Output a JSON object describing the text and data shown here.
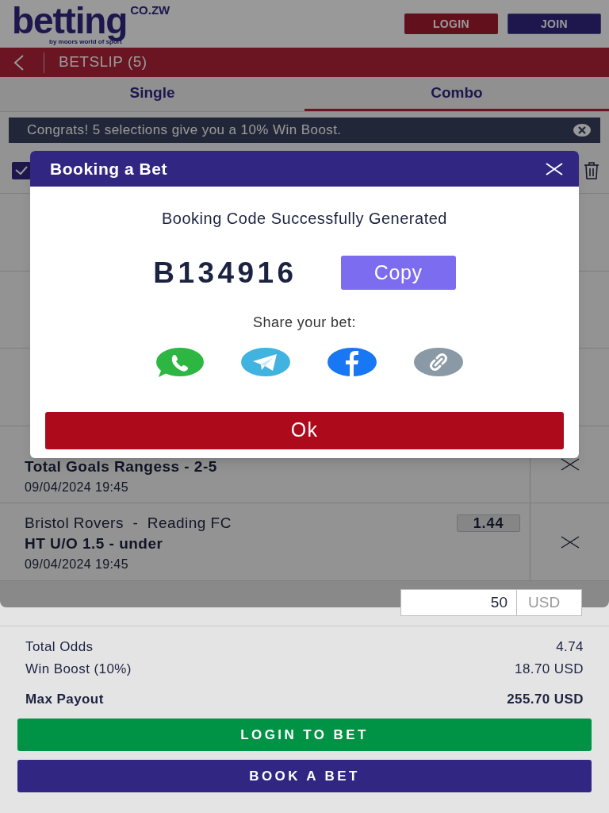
{
  "header": {
    "logo": {
      "word": "betting",
      "domain": "CO.ZW",
      "tagline": "by moors world of sport"
    },
    "buttons": [
      {
        "label": "LOGIN",
        "kind": "login"
      },
      {
        "label": "JOIN",
        "kind": "join"
      }
    ]
  },
  "betslip": {
    "title": "BETSLIP (5)"
  },
  "tabs": [
    {
      "label": "Single",
      "selected": false
    },
    {
      "label": "Combo",
      "selected": true
    }
  ],
  "banner": {
    "text": "Congrats! 5 selections give you a 10% Win Boost."
  },
  "select_all": {
    "checked": true
  },
  "selections": [
    {
      "market": "Total Goals Rangess - 2-5",
      "time": "09/04/2024 19:45"
    },
    {
      "teams": "Bristol Rovers  -  Reading FC",
      "market": "HT U/O 1.5 - under",
      "time": "09/04/2024 19:45",
      "odds": "1.44"
    }
  ],
  "stake": {
    "value": "50",
    "currency": "USD"
  },
  "summary": [
    {
      "label": "Total Odds",
      "value": "4.74",
      "kind": "normal"
    },
    {
      "label": "Win Boost (10%)",
      "value": "18.70 USD",
      "kind": "normal"
    },
    {
      "label": "Max Payout",
      "value": "255.70 USD",
      "kind": "total"
    }
  ],
  "actions": [
    {
      "label": "LOGIN TO BET",
      "kind": "login"
    },
    {
      "label": "BOOK A BET",
      "kind": "book"
    }
  ],
  "modal": {
    "title": "Booking a Bet",
    "message": "Booking Code Successfully Generated",
    "code": "B134916",
    "copy_label": "Copy",
    "share_label": "Share your bet:",
    "share": [
      {
        "kind": "whatsapp"
      },
      {
        "kind": "telegram"
      },
      {
        "kind": "facebook"
      },
      {
        "kind": "link"
      }
    ],
    "ok_label": "Ok"
  }
}
